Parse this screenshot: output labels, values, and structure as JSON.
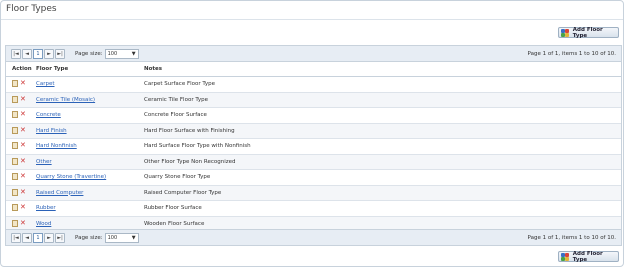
{
  "page": {
    "title": "Floor Types"
  },
  "toolbar": {
    "add_label": "Add Floor Type"
  },
  "pager": {
    "first": "|◄",
    "prev": "◄",
    "current_page": "1",
    "next": "►",
    "last": "►|",
    "page_size_label": "Page size:",
    "page_size": "100",
    "info": "Page 1 of 1, items 1 to 10 of 10."
  },
  "grid": {
    "columns": {
      "action": "Action",
      "type": "Floor Type",
      "notes": "Notes"
    },
    "rows": [
      {
        "type": "Carpet",
        "notes": "Carpet Surface Floor Type"
      },
      {
        "type": "Ceramic Tile (Mosaic)",
        "notes": "Ceramic Tile Floor Type"
      },
      {
        "type": "Concrete",
        "notes": "Concrete Floor Surface"
      },
      {
        "type": "Hard Finish",
        "notes": "Hard Floor Surface with Finishing"
      },
      {
        "type": "Hard Nonfinish",
        "notes": "Hard Surface Floor Type with Nonfinish"
      },
      {
        "type": "Other",
        "notes": "Other Floor Type Non Recognized"
      },
      {
        "type": "Quarry Stone (Travertine)",
        "notes": "Quarry Stone Floor Type"
      },
      {
        "type": "Raised Computer",
        "notes": "Raised Computer Floor Type"
      },
      {
        "type": "Rubber",
        "notes": "Rubber Floor Surface"
      },
      {
        "type": "Wood",
        "notes": "Wooden Floor Surface"
      }
    ]
  },
  "colors": {
    "link": "#2b62b8",
    "header_bg": "#e7edf4",
    "border": "#c8d2dc"
  }
}
